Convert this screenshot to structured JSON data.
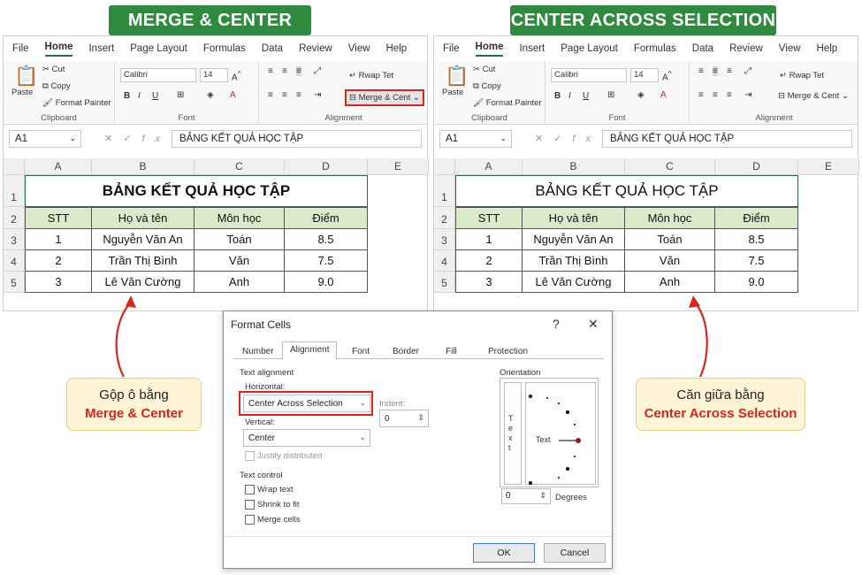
{
  "banners": {
    "left": "MERGE & CENTER",
    "right": "CENTER ACROSS SELECTION"
  },
  "ribbon": {
    "tabs": [
      "File",
      "Home",
      "Insert",
      "Page Layout",
      "Formulas",
      "Data",
      "Review",
      "View",
      "Help"
    ],
    "paste": "Paste",
    "cut": "Cut",
    "copy": "Copy",
    "format_painter": "Format Painter",
    "font": "Calibri",
    "size": "14",
    "wrap": "Rwap Tet",
    "merge": "Merge & Cent",
    "groups": {
      "clipboard": "Clipboard",
      "font": "Font",
      "alignment": "Alignment"
    }
  },
  "formula_bar": {
    "name": "A1",
    "fx": "fx",
    "content": "BẢNG KẾT QUẢ HỌC TẬP"
  },
  "sheet": {
    "columns": [
      "A",
      "B",
      "C",
      "D",
      "E"
    ],
    "rows": [
      "1",
      "2",
      "3",
      "4",
      "5"
    ],
    "title": "BẢNG KẾT QUẢ HỌC TẬP",
    "headers": [
      "STT",
      "Họ và tên",
      "Môn học",
      "Điểm"
    ],
    "data": [
      [
        "1",
        "Nguyễn Văn An",
        "Toán",
        "8.5"
      ],
      [
        "2",
        "Trần Thị Bình",
        "Văn",
        "7.5"
      ],
      [
        "3",
        "Lê Văn Cường",
        "Anh",
        "9.0"
      ]
    ]
  },
  "dialog": {
    "title": "Format Cells",
    "help": "?",
    "close": "✕",
    "tabs": [
      "Number",
      "Alignment",
      "Font",
      "Border",
      "Fill",
      "Protection"
    ],
    "text_alignment": "Text alignment",
    "horizontal_label": "Horizontal:",
    "horizontal_value": "Center Across Selection",
    "indent_label": "Indent:",
    "indent_value": "0",
    "vertical_label": "Vertical:",
    "vertical_value": "Center",
    "justify": "Justify distributed",
    "text_control": "Text control",
    "wrap": "Wrap text",
    "shrink": "Shrink to fit",
    "merge": "Merge cells",
    "orientation": "Orientation",
    "orient_text": "Text",
    "orient_vertical": "T e x t",
    "degrees_value": "0",
    "degrees_label": "Degrees",
    "ok": "OK",
    "cancel": "Cancel"
  },
  "callouts": {
    "left_line1": "Gộp ô bằng",
    "left_line2": "Merge & Center",
    "right_line1": "Căn giữa bằng",
    "right_line2": "Center Across Selection"
  },
  "colors": {
    "banner": "#2e8b3d",
    "header_fill": "#d9ebc9",
    "highlight": "#d7261e",
    "callout_fill": "#fff4d6"
  }
}
